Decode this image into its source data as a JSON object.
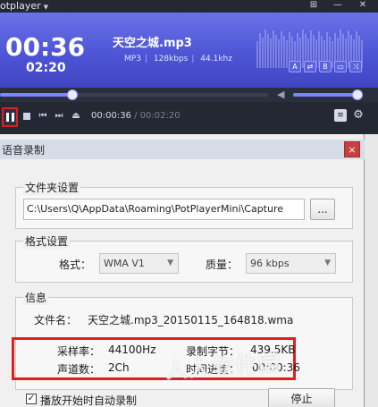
{
  "player": {
    "app_title": "otplayer",
    "window_controls": [
      "pin-icon",
      "minimize-icon",
      "close-icon"
    ],
    "elapsed_big": "00:36",
    "total_small": "02:20",
    "track_title": "天空之城.mp3",
    "track_format": "MP3",
    "track_bitrate": "128kbps",
    "track_samplerate": "44.1khz",
    "mode_icons": [
      "A",
      "⇄",
      "B",
      "▭",
      "⤨"
    ],
    "seek_progress": 0.27,
    "volume_level": 0.95,
    "time_elapsed": "00:00:36",
    "time_separator": "/",
    "time_total": "00:02:20",
    "accent_color": "#5a61e0",
    "highlight_color": "#e01e1e"
  },
  "dialog": {
    "title": "语音录制",
    "close_icon": "×",
    "folder_group_label": "文件夹设置",
    "folder_path": "C:\\Users\\Q\\AppData\\Roaming\\PotPlayerMini\\Capture",
    "browse_label": "...",
    "format_group_label": "格式设置",
    "format_label": "格式：",
    "format_value": "WMA V1",
    "quality_label": "质量：",
    "quality_value": "96 kbps",
    "info_group_label": "信息",
    "filename_label": "文件名：",
    "filename_value": "天空之城.mp3_20150115_164818.wma",
    "samplerate_label": "采样率：",
    "samplerate_value": "44100Hz",
    "bytes_label": "录制字节：",
    "bytes_value": "439.5KB",
    "channels_label": "声道数：",
    "channels_value": "2Ch",
    "progress_label": "时间进度：",
    "progress_value": "00:00:36",
    "auto_record_label": "播放开始时自动录制",
    "auto_record_checked": true,
    "stop_label": "停止"
  },
  "watermark_text": "人人软件园"
}
